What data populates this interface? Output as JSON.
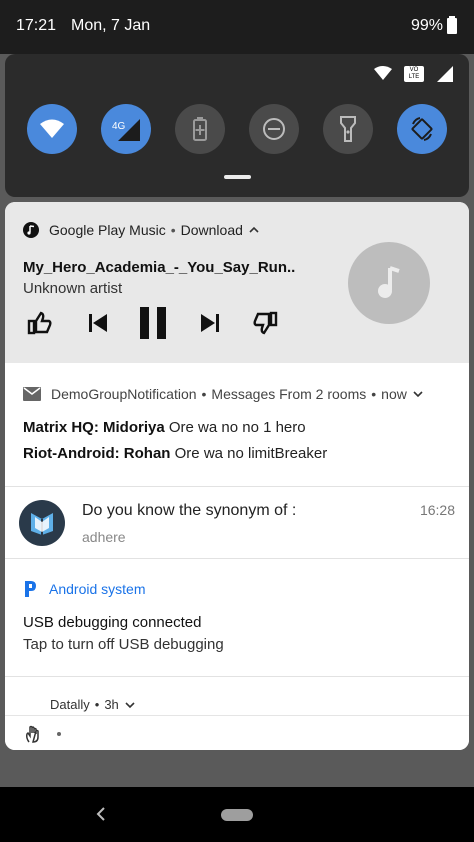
{
  "status_bar": {
    "time": "17:21",
    "date": "Mon, 7 Jan",
    "battery": "99%"
  },
  "quick_settings": {
    "tiles": [
      {
        "name": "wifi",
        "state": "on",
        "icon": "wifi-icon"
      },
      {
        "name": "mobile-data",
        "state": "on",
        "icon": "signal-4g-icon",
        "badge": "4G"
      },
      {
        "name": "battery-saver",
        "state": "off",
        "icon": "battery-saver-icon"
      },
      {
        "name": "do-not-disturb",
        "state": "off",
        "icon": "dnd-icon"
      },
      {
        "name": "flashlight",
        "state": "off",
        "icon": "flashlight-icon"
      },
      {
        "name": "auto-rotate",
        "state": "on",
        "icon": "auto-rotate-icon"
      }
    ],
    "volte_label": "VO LTE"
  },
  "media": {
    "app": "Google Play Music",
    "action": "Download",
    "title": "My_Hero_Academia_-_You_Say_Run..",
    "artist": "Unknown artist"
  },
  "group_notification": {
    "app": "DemoGroupNotification",
    "summary": "Messages From 2 rooms",
    "when": "now",
    "lines": [
      {
        "sender": "Matrix HQ: Midoriya",
        "text": "Ore wa no no 1 hero"
      },
      {
        "sender": "Riot-Android: Rohan",
        "text": "Ore wa no limitBreaker"
      }
    ]
  },
  "synonym": {
    "title": "Do you know the synonym of :",
    "word": "adhere",
    "time": "16:28"
  },
  "system": {
    "app": "Android system",
    "title": "USB debugging connected",
    "text": "Tap to turn off USB debugging"
  },
  "datally": {
    "app": "Datally",
    "when": "3h"
  },
  "colors": {
    "accent": "#4a89dc",
    "link": "#1a73e8"
  }
}
